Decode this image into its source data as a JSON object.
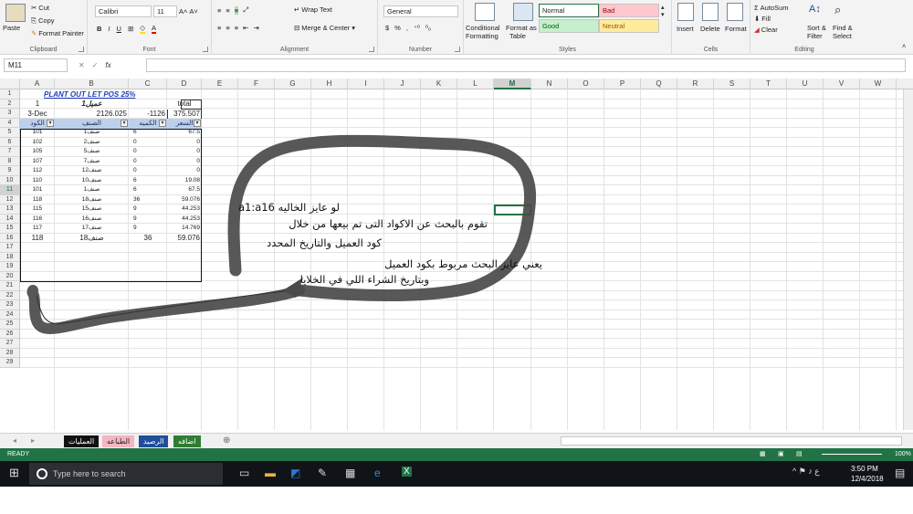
{
  "ribbon": {
    "clipboard": {
      "paste": "Paste",
      "cut": "Cut",
      "copy": "Copy",
      "format_painter": "Format Painter",
      "label": "Clipboard"
    },
    "font": {
      "name": "Calibri",
      "size": "11",
      "bold": "B",
      "italic": "I",
      "underline": "U",
      "label": "Font"
    },
    "alignment": {
      "wrap_text": "Wrap Text",
      "merge_center": "Merge & Center",
      "label": "Alignment"
    },
    "number": {
      "format": "General",
      "currency": "$",
      "percent": "%",
      "comma": ",",
      "label": "Number"
    },
    "styles": {
      "conditional": "Conditional",
      "formatting": "Formatting",
      "format_as": "Format as",
      "table": "Table",
      "normal": "Normal",
      "bad": "Bad",
      "good": "Good",
      "neutral": "Neutral",
      "label": "Styles"
    },
    "cells": {
      "insert": "Insert",
      "delete": "Delete",
      "format": "Format",
      "label": "Cells"
    },
    "editing": {
      "autosum": "AutoSum",
      "fill": "Fill",
      "clear": "Clear",
      "sort": "Sort &",
      "filter": "Filter",
      "find": "Find &",
      "select": "Select",
      "label": "Editing"
    }
  },
  "formula_bar": {
    "name_box": "M11",
    "fx": "fx",
    "value": ""
  },
  "columns": [
    "A",
    "B",
    "C",
    "D",
    "E",
    "F",
    "G",
    "H",
    "I",
    "J",
    "K",
    "L",
    "M",
    "N",
    "O",
    "P",
    "Q",
    "R",
    "S",
    "T",
    "U",
    "V",
    "W"
  ],
  "active_column": "M",
  "active_row": 11,
  "rows_count": 29,
  "sheet": {
    "title": "PLANT OUT LET POS 25%",
    "r2": {
      "a": "1",
      "b": "عميل1",
      "d": "total"
    },
    "r3": {
      "a": "3-Dec",
      "b": "2126.025",
      "c": "-1126",
      "d": "375.507"
    },
    "headers": {
      "a": "الكود",
      "b": "الصنف",
      "c": "الكميه",
      "d": "السعر"
    },
    "rows": [
      {
        "a": "101",
        "b": "صنف1",
        "c": "6",
        "d": "67.5"
      },
      {
        "a": "102",
        "b": "صنف2",
        "c": "0",
        "d": "0"
      },
      {
        "a": "105",
        "b": "صنف5",
        "c": "0",
        "d": "0"
      },
      {
        "a": "107",
        "b": "صنف7",
        "c": "0",
        "d": "0"
      },
      {
        "a": "112",
        "b": "صنف12",
        "c": "0",
        "d": "0"
      },
      {
        "a": "110",
        "b": "صنف10",
        "c": "6",
        "d": "19.08"
      },
      {
        "a": "101",
        "b": "صنف1",
        "c": "6",
        "d": "67.5"
      },
      {
        "a": "118",
        "b": "صنف18",
        "c": "36",
        "d": "59.076"
      },
      {
        "a": "115",
        "b": "صنف15",
        "c": "9",
        "d": "44.253"
      },
      {
        "a": "116",
        "b": "صنف16",
        "c": "9",
        "d": "44.253"
      },
      {
        "a": "117",
        "b": "صنف17",
        "c": "9",
        "d": "14.769"
      },
      {
        "a": "118",
        "b": "صنف18",
        "c": "36",
        "d": "59.076"
      }
    ]
  },
  "annotation": {
    "line1": "لو عايز الخاليه a1:a16",
    "line2": "تقوم بالبحث عن الاكواد التى تم بيعها من خلال",
    "line3": "كود العميل والتاريخ المحدد",
    "line4": "يعني عايز البحث مربوط بكود العميل",
    "line5": "وبتاريخ الشراء اللي في الخلايا"
  },
  "tabs": [
    {
      "label": "العمليات",
      "color": "#111111"
    },
    {
      "label": "الطباعه",
      "color": "#f4b6c2"
    },
    {
      "label": "الرصيد",
      "color": "#1f4e9a"
    },
    {
      "label": "اضافه",
      "color": "#2e7d32"
    }
  ],
  "status": {
    "ready": "READY",
    "zoom": "100%"
  },
  "taskbar": {
    "search": "Type here to search",
    "time": "3:50 PM",
    "date": "12/4/2018"
  },
  "colors": {
    "excel_green": "#217346",
    "style_bad": "#ffc7ce",
    "style_good": "#c6efce",
    "style_neutral": "#ffeb9c"
  }
}
